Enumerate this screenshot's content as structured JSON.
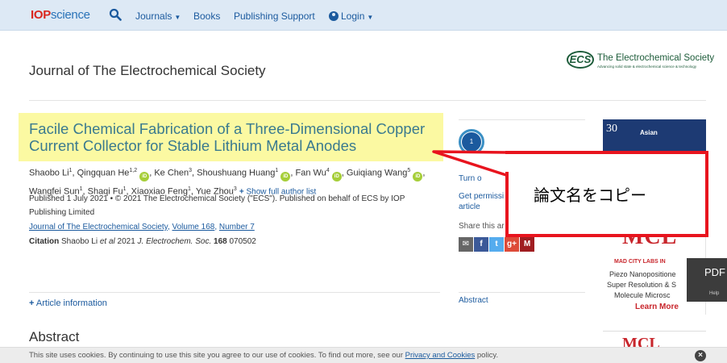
{
  "nav": {
    "logo_iop": "IOP",
    "logo_science": "science",
    "items": [
      "Journals",
      "Books",
      "Publishing Support",
      "Login"
    ]
  },
  "journal": {
    "title": "Journal of The Electrochemical Society",
    "society_name": "The Electrochemical Society",
    "society_badge": "ECS",
    "society_tagline": "Advancing solid state & electrochemical science & technology"
  },
  "article": {
    "title": "Facile Chemical Fabrication of a Three-Dimensional Copper Current Collector for Stable Lithium Metal Anodes",
    "authors": [
      {
        "name": "Shaobo Li",
        "sup": "1",
        "orcid": false
      },
      {
        "name": "Qingquan He",
        "sup": "1,2",
        "orcid": true
      },
      {
        "name": "Ke Chen",
        "sup": "3",
        "orcid": false
      },
      {
        "name": "Shoushuang Huang",
        "sup": "1",
        "orcid": true
      },
      {
        "name": "Fan Wu",
        "sup": "4",
        "orcid": true
      },
      {
        "name": "Guiqiang Wang",
        "sup": "5",
        "orcid": true
      },
      {
        "name": "Wangfei Sun",
        "sup": "1",
        "orcid": false
      },
      {
        "name": "Shaqi Fu",
        "sup": "1",
        "orcid": false
      },
      {
        "name": "Xiaoxiao Feng",
        "sup": "1",
        "orcid": false
      },
      {
        "name": "Yue Zhou",
        "sup": "3",
        "orcid": false
      }
    ],
    "show_all_authors": "Show full author list",
    "published": "Published 1 July 2021 • © 2021 The Electrochemical Society (\"ECS\"). Published on behalf of ECS by IOP Publishing Limited",
    "journal_link": "Journal of The Electrochemical Society",
    "volume_link": "Volume 168",
    "number_link": "Number 7",
    "citation_label": "Citation",
    "citation_authors": "Shaobo Li",
    "citation_etal": "et al",
    "citation_year": "2021",
    "citation_journal": "J. Electrochem. Soc.",
    "citation_volume": "168",
    "citation_number": "070502",
    "article_info": "Article information",
    "abstract_heading": "Abstract"
  },
  "sidebar": {
    "metric_value": "1",
    "turn_on": "Turn o",
    "get_permission": "Get permissi",
    "article_word": "article",
    "share": "Share this ar",
    "abstract": "Abstract",
    "share_icons": [
      {
        "name": "email-icon",
        "glyph": "✉",
        "color": "#666666"
      },
      {
        "name": "facebook-icon",
        "glyph": "f",
        "color": "#3b5998"
      },
      {
        "name": "twitter-icon",
        "glyph": "t",
        "color": "#55acee"
      },
      {
        "name": "google-plus-icon",
        "glyph": "g+",
        "color": "#dd4b39"
      },
      {
        "name": "mendeley-icon",
        "glyph": "M",
        "color": "#a01d21"
      }
    ]
  },
  "ads": {
    "ad1_number": "30",
    "ad1_logo": "Asian",
    "mcl_big": "MCL",
    "mcl_name": "MAD CITY LABS IN",
    "lines": [
      "Piezo Nanopositione",
      "Super Resolution & S",
      "Molecule Microsc"
    ],
    "learn_more": "Learn More",
    "ad3_text": "MCL"
  },
  "pdf_tab": {
    "label": "PDF",
    "help": "Help"
  },
  "callout": {
    "text": "論文名をコピー"
  },
  "cookie": {
    "text_before": "This site uses cookies. By continuing to use this site you agree to our use of cookies. To find out more, see our ",
    "link": "Privacy and Cookies",
    "text_after": " policy.",
    "close": "×"
  },
  "colors": {
    "accent": "#1b5a9e",
    "title_color": "#3a7a8f",
    "highlight": "#fbf9a2",
    "callout_border": "#e8141e",
    "nav_bg": "#dde9f5"
  }
}
